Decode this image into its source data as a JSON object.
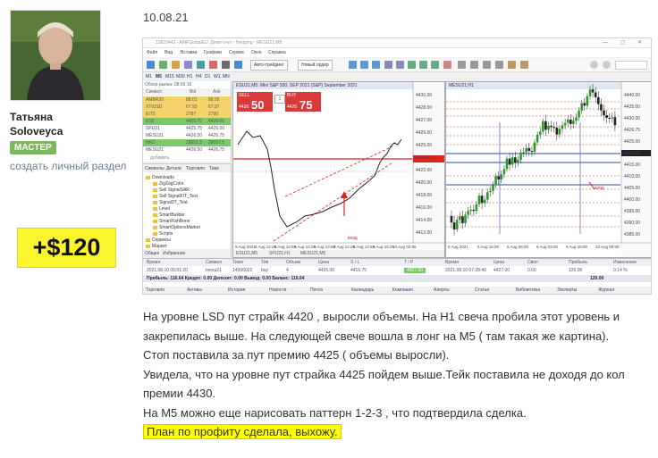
{
  "profile": {
    "first_name": "Татьяна",
    "last_name": "Soloveyca",
    "badge": "МАСТЕР",
    "create_link": "создать личный раздел",
    "profit": "+$120"
  },
  "post": {
    "date": "10.08.21",
    "paragraphs": [
      "На уровне LSD пут страйк 4420 , выросли объемы. На Н1 свеча пробила этот уровень и закрепилась выше. На следующей свече вошла в лонг на М5 ( там такая же картина).",
      "Стоп  поставила за пут премию 4425 ( объемы выросли).",
      "Увидела, что на уровне пут страйка 4425 пойдем выше.Тейк поставила не доходя до кол премии 4430.",
      "На М5 можно еще нарисовать  паттерн 1-2-3 , что подтвердила сделка."
    ],
    "highlight": "План по профиту сделала, выхожу."
  },
  "terminal": {
    "title": "12823443 - AMPGlobalEU: Демо-счет - Hedging - MESU21,M5",
    "menu": [
      "Файл",
      "Вид",
      "Вставка",
      "Графики",
      "Сервис",
      "Окно",
      "Справка"
    ],
    "algo_button": "Авто-трейдинг",
    "new_order_button": "Новый ордер",
    "timeframes": [
      "M1",
      "M5",
      "M15",
      "M30",
      "H1",
      "H4",
      "D1",
      "W1",
      "MN"
    ],
    "market_watch": {
      "title": "Обзор рынка: 08:09:16",
      "columns": [
        "Символ",
        "Bid",
        "Ask"
      ],
      "rows": [
        {
          "symbol": "AMBR20",
          "bid": "88.01",
          "ask": "88.05",
          "color": "#f5d36a"
        },
        {
          "symbol": "XTIUSD",
          "bid": "67.93",
          "ask": "67.97",
          "color": "#f5d36a"
        },
        {
          "symbol": "EIT5",
          "bid": "2787",
          "ask": "2790",
          "color": "#f5d36a"
        },
        {
          "symbol": "ES5",
          "bid": "4425.75",
          "ask": "4426.00",
          "color": "#7fc86a"
        },
        {
          "symbol": "SPU21",
          "bid": "4425.75",
          "ask": "4426.00",
          "color": "#ffffff"
        },
        {
          "symbol": "MESU21",
          "bid": "4426.50",
          "ask": "4426.75",
          "color": "#ffffff"
        },
        {
          "symbol": "NKD",
          "bid": "28051.5",
          "ask": "28057.5",
          "color": "#7fc86a"
        },
        {
          "symbol": "MESU21",
          "bid": "4426.50",
          "ask": "4426.75",
          "color": "#ffffff"
        }
      ],
      "add_hint": "добавить"
    },
    "navigator": {
      "tabs": [
        "Символы",
        "Детали",
        "Торговля",
        "Тики"
      ],
      "items": [
        "Downloads",
        "ZigZagColor",
        "Sell SignalSAR",
        "Sell SignalFIT_Test",
        "Signal3T_Test",
        "Level",
        "SmartBuilder",
        "SmartFishBone",
        "SmartOptionsMarket",
        "Scripts",
        "Сервисы",
        "Маркет"
      ],
      "bottom_tabs": [
        "Общее",
        "Избранное"
      ]
    },
    "chart_left": {
      "header": "ESU21,M5: Mini S&P 500, SEP 2021 (S&P) September 2021",
      "sell": {
        "label": "SELL",
        "big": "50",
        "prefix": "4426"
      },
      "buy": {
        "label": "BUY",
        "big": "75",
        "prefix": "4426"
      },
      "lot": "1",
      "annotation": "вход",
      "price_labels": [
        "4430.00",
        "4428.00",
        "4427.00",
        "4426.50",
        "4425.00",
        "4424.00",
        "4422.00",
        "4420.00",
        "4418.00",
        "4416.00",
        "4414.00",
        "4412.00"
      ],
      "time_labels": [
        "9 Aug 2021",
        "9 Aug 12:25",
        "9 Aug 12:55",
        "9 Aug 13:25",
        "9 Aug 13:55",
        "9 Aug 14:25",
        "9 Aug 14:55",
        "9 Aug 15:25",
        "10 Aug 02:55"
      ],
      "tabs": [
        "ESU21,M5",
        "SPU21,H1",
        "MESU21,M5"
      ]
    },
    "chart_right": {
      "header": "MESU21,H1",
      "annotation": "вход",
      "price_labels": [
        "4440.00",
        "4435.00",
        "4430.00",
        "4426.75",
        "4425.00",
        "4420.00",
        "4415.00",
        "4410.00",
        "4405.00",
        "4400.00",
        "4395.00",
        "4390.00",
        "4385.00"
      ],
      "time_labels": [
        "5 Aug 2021",
        "5 Aug 15:00",
        "6 Aug 06:00",
        "9 Aug 03:00",
        "9 Aug 15:00",
        "10 Aug 00:00"
      ]
    },
    "trades": {
      "columns": [
        "Время",
        "Символ",
        "Тикет",
        "Тип",
        "Объем",
        "Цена",
        "S / L",
        "T / P",
        "Время",
        "Цена",
        "Своп",
        "Прибыль",
        "Изменение"
      ],
      "row": [
        "2021.08.10 05:01:20",
        "mesu21",
        "14006022",
        "buy",
        "4",
        "4425.00",
        "4416.75",
        "4427.00",
        "2021.08.10 07:28:40",
        "4427.00",
        "0.00",
        "120.00",
        "0.14 %"
      ],
      "summary": "Прибыль: 116.64  Кредит: 0.00  Депозит: 0.00  Вывод: 0.00  Баланс: 116.64",
      "summary_total": "120.00",
      "tabs": [
        "Торговля",
        "Активы",
        "История",
        "Новости",
        "Почта",
        "Календарь",
        "Компания",
        "Алерты",
        "Статьи",
        "Библиотека",
        "Эксперты",
        "Журнал"
      ]
    }
  }
}
